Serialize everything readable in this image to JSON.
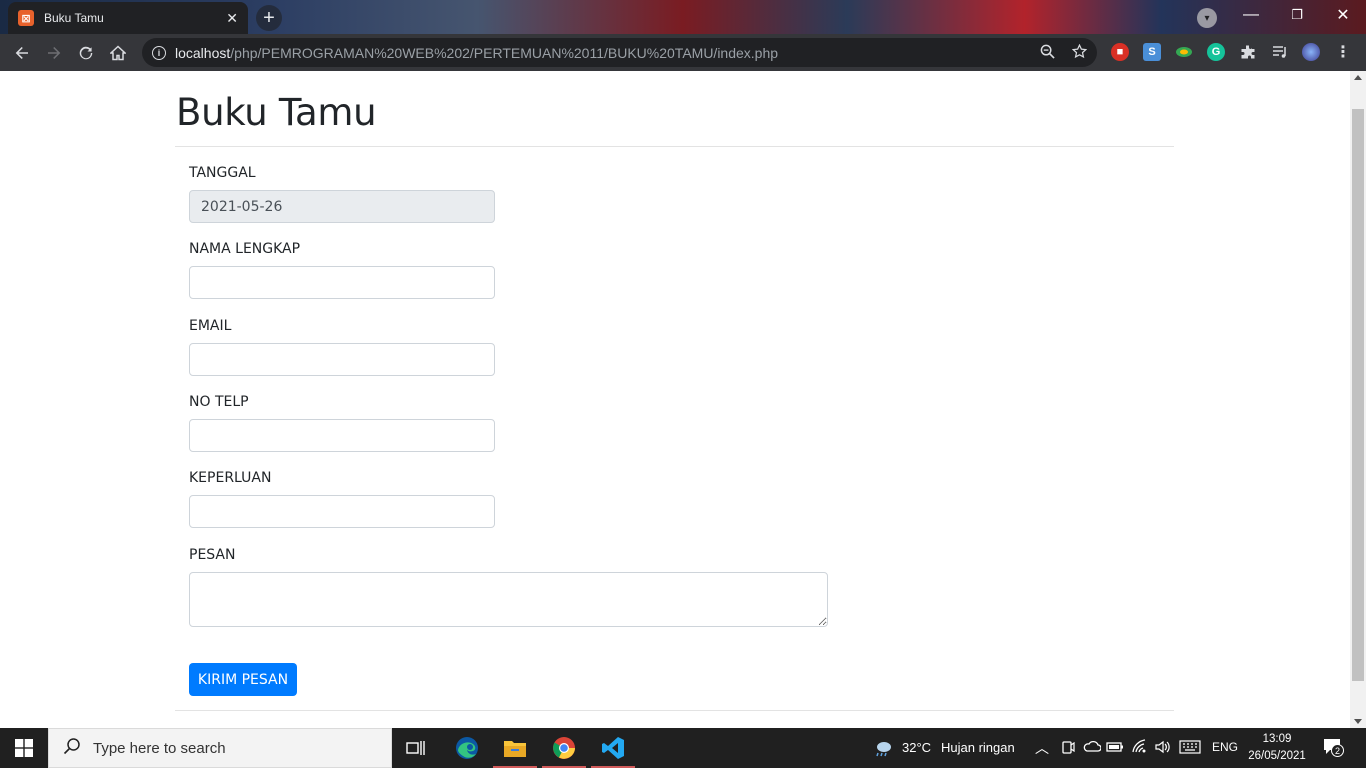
{
  "browser": {
    "tab_title": "Buku Tamu",
    "favicon_text": "⊠",
    "tab_close": "✕",
    "new_tab": "+",
    "url_host": "localhost",
    "url_path": "/php/PEMROGRAMAN%20WEB%202/PERTEMUAN%2011/BUKU%20TAMU/index.php",
    "window_controls": {
      "minimize": "—",
      "restore": "❐",
      "close": "✕"
    }
  },
  "page": {
    "title": "Buku Tamu",
    "form": {
      "tanggal_label": "TANGGAL",
      "tanggal_value": "2021-05-26",
      "nama_label": "NAMA LENGKAP",
      "nama_value": "",
      "email_label": "EMAIL",
      "email_value": "",
      "telp_label": "NO TELP",
      "telp_value": "",
      "keperluan_label": "KEPERLUAN",
      "keperluan_value": "",
      "pesan_label": "PESAN",
      "pesan_value": "",
      "submit_label": "KIRIM PESAN"
    }
  },
  "taskbar": {
    "search_placeholder": "Type here to search",
    "weather_temp": "32°C",
    "weather_desc": "Hujan ringan",
    "language": "ENG",
    "time": "13:09",
    "date": "26/05/2021",
    "notification_count": "2"
  },
  "colors": {
    "primary": "#007bff",
    "readonly_bg": "#e9ecef",
    "toolbar": "#35363a",
    "taskbar": "#202020"
  }
}
